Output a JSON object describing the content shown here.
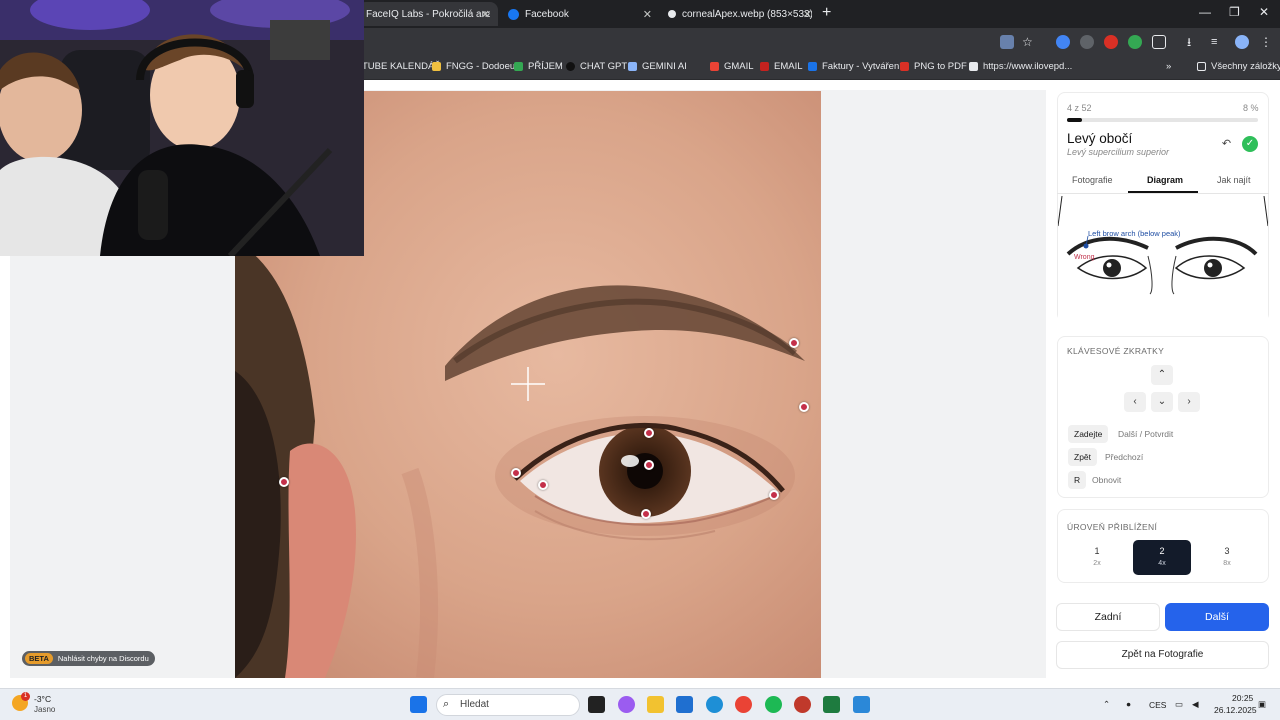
{
  "browser": {
    "tabs": [
      {
        "title": "FaceIQ Labs - Pokročilá analýza",
        "active": true
      },
      {
        "title": "Facebook",
        "active": false
      },
      {
        "title": "cornealApex.webp (853×533)",
        "active": false
      }
    ],
    "bookmarks": [
      "TUBE KALENDÁŘ",
      "FNGG - Dodoeu",
      "PŘÍJEM",
      "CHAT GPT",
      "GEMINI AI",
      "GMAIL",
      "EMAIL",
      "Faktury - Vytváření",
      "PNG to PDF",
      "https://www.ilovepd..."
    ],
    "all_bookmarks": "Všechny záložky"
  },
  "sidebar": {
    "progress_label": "4 z 52",
    "progress_percent": "8 %",
    "progress_value": 0.08,
    "landmark_title": "Levý obočí",
    "landmark_subtitle": "Levý supercilium superior",
    "tabs": [
      "Fotografie",
      "Diagram",
      "Jak najít"
    ],
    "active_tab": "Diagram",
    "diagram_label": "Left brow arch (below peak)",
    "diagram_wrong": "Wrong",
    "shortcuts_title": "KLÁVESOVÉ ZKRATKY",
    "shortcuts": [
      {
        "key": "Zadejte",
        "desc": "Další / Potvrdit"
      },
      {
        "key": "Zpět",
        "desc": "Předchozí"
      },
      {
        "key": "R",
        "desc": "Obnovit"
      }
    ],
    "zoom_title": "ÚROVEŇ PŘIBLÍŽENÍ",
    "zoom_levels": [
      {
        "n": "1",
        "s": "2x"
      },
      {
        "n": "2",
        "s": "4x"
      },
      {
        "n": "3",
        "s": "8x"
      }
    ],
    "active_zoom": "2",
    "back_label": "Zadní",
    "next_label": "Další",
    "photos_label": "Zpět na Fotografie"
  },
  "beta": {
    "tag": "BETA",
    "text": "Nahlásit chyby na Discordu"
  },
  "taskbar": {
    "weather_temp": "-3°C",
    "weather_state": "Jasno",
    "search_placeholder": "Hledat",
    "lang": "CES",
    "time": "20:25",
    "date": "26.12.2025"
  }
}
